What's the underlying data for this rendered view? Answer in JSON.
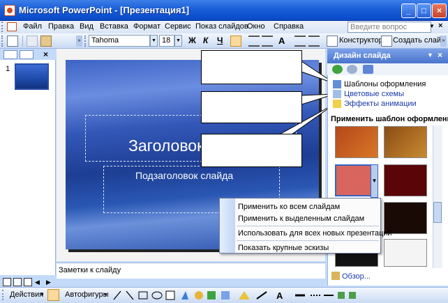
{
  "window": {
    "title": "Microsoft PowerPoint - [Презентация1]",
    "minimize": "_",
    "maximize": "□",
    "close": "×"
  },
  "menu": {
    "items": [
      "Файл",
      "Правка",
      "Вид",
      "Вставка",
      "Формат",
      "Сервис",
      "Показ слайдов",
      "Окно",
      "Справка"
    ],
    "help_placeholder": "Введите вопрос",
    "mdi_close": "×"
  },
  "toolbar": {
    "font_name": "Tahoma",
    "font_size": "18",
    "bold": "Ж",
    "italic": "К",
    "underline": "Ч",
    "font_color": "A",
    "designer_label": "Конструктор",
    "new_slide_label": "Создать слайд"
  },
  "thumbnails": {
    "slide_number": "1"
  },
  "slide": {
    "title": "Заголовок",
    "subtitle": "Подзаголовок слайда"
  },
  "notes": {
    "placeholder": "Заметки к слайду"
  },
  "taskpane": {
    "title": "Дизайн слайда",
    "close": "×",
    "links": [
      "Шаблоны оформления",
      "Цветовые схемы",
      "Эффекты анимации"
    ],
    "apply_label": "Применить шаблон оформления:",
    "browse": "Обзор..."
  },
  "context_menu": {
    "items": [
      "Применить ко всем слайдам",
      "Применить к выделенным слайдам",
      "Использовать для всех новых презентаций",
      "Показать крупные эскизы"
    ]
  },
  "drawbar": {
    "actions": "Действия",
    "autoshapes": "Автофигуры"
  },
  "colors": {
    "titlebar": "#0a49c6",
    "taskpane_header": "#4a74cc",
    "slide_bg": "#2a57b4",
    "link": "#1a3aaa"
  }
}
